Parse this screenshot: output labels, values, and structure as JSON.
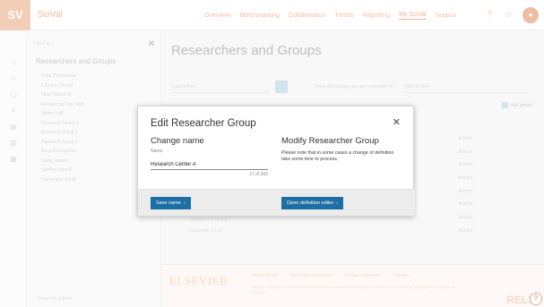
{
  "app": {
    "logo_text": "SV",
    "brand": "SciVal"
  },
  "nav": {
    "items": [
      "Overview",
      "Benchmarking",
      "Collaboration",
      "Trends",
      "Reporting",
      "My SciVal",
      "Scopus"
    ],
    "active": "My SciVal"
  },
  "sidebar": {
    "search_placeholder": "Find a...",
    "title": "Researchers and Groups",
    "items": [
      "Sofia Zimmerman",
      "Charles Conrad",
      "Maja Warum R.",
      "Researcher Test Stub",
      "Janine Leif",
      "Research Center A",
      "Research Group 1",
      "Research Group 2",
      "Bergi Researcher",
      "Sindy Jensen",
      "Sunitha Leon R.",
      "Transmittal Shruti"
    ],
    "footer": "Show the options"
  },
  "main": {
    "title": "Researchers and Groups",
    "search_placeholder": "Type to filter",
    "filter_label": "Show only groups you are a member of",
    "type_label": "Filter by type",
    "add_button": "Add people",
    "row_actions": [
      "Actions",
      "Actions",
      "Actions",
      "Actions",
      "Actions",
      "Actions",
      "Actions",
      "Actions"
    ],
    "rows": [
      "Research Group 2",
      "Transmittal Shruti"
    ]
  },
  "footer": {
    "logo": "ELSEVIER",
    "links": [
      "About SciVal",
      "Terms and conditions",
      "Privacy statement",
      "Cookies"
    ],
    "text": "We use cookies to help provide and enhance our service and tailor content. By continuing, you agree to the use of cookies.",
    "relx": "RELX"
  },
  "modal": {
    "title": "Edit Researcher Group",
    "close_icon": "close-icon",
    "change_name": {
      "heading": "Change name",
      "field_label": "Name",
      "value": "Research Center A",
      "char_count": "17 of 300",
      "button": "Save name"
    },
    "modify": {
      "heading": "Modify Researcher Group",
      "note": "Please note that in some cases a change of definition take some time to process.",
      "button": "Open definition editor"
    }
  }
}
